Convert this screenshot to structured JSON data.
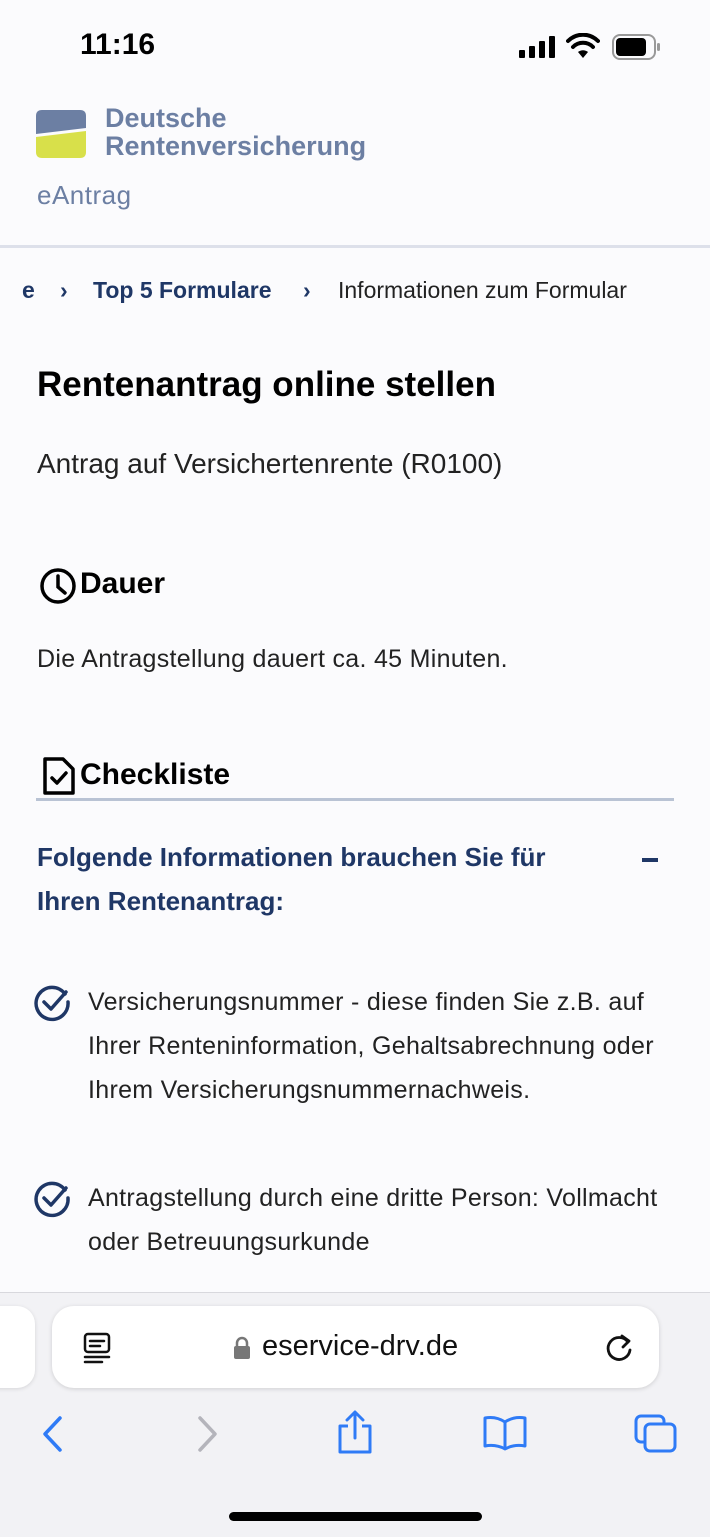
{
  "status_bar": {
    "time": "11:16"
  },
  "header": {
    "logo_line1": "Deutsche",
    "logo_line2": "Rentenversicherung",
    "subtitle": "eAntrag",
    "brand_colors": {
      "blue": "#6c7fa3",
      "yellow": "#d8e04a",
      "navy": "#1f3766"
    }
  },
  "breadcrumb": {
    "items": [
      "e",
      "Top 5 Formulare",
      "Informationen zum Formular"
    ]
  },
  "main": {
    "title": "Rentenantrag online stellen",
    "subtitle": "Antrag auf Versichertenrente (R0100)",
    "duration": {
      "heading": "Dauer",
      "text": "Die Antragstellung dauert ca. 45 Minuten."
    },
    "checklist": {
      "heading": "Checkliste",
      "accordion_title": "Folgende Informationen brauchen Sie für Ihren Rentenantrag:",
      "items": [
        "Versicherungsnummer - diese finden Sie z.B. auf Ihrer Renteninformation, Gehaltsabrechnung oder Ihrem Versicherungsnummernachweis.",
        "Antragstellung durch eine dritte Person: Vollmacht oder Betreuungsurkunde"
      ]
    }
  },
  "browser": {
    "url": "eservice-drv.de",
    "icons": [
      "reader-icon",
      "lock-icon",
      "reload-icon",
      "back-icon",
      "forward-icon",
      "share-icon",
      "bookmarks-icon",
      "tabs-icon"
    ]
  }
}
